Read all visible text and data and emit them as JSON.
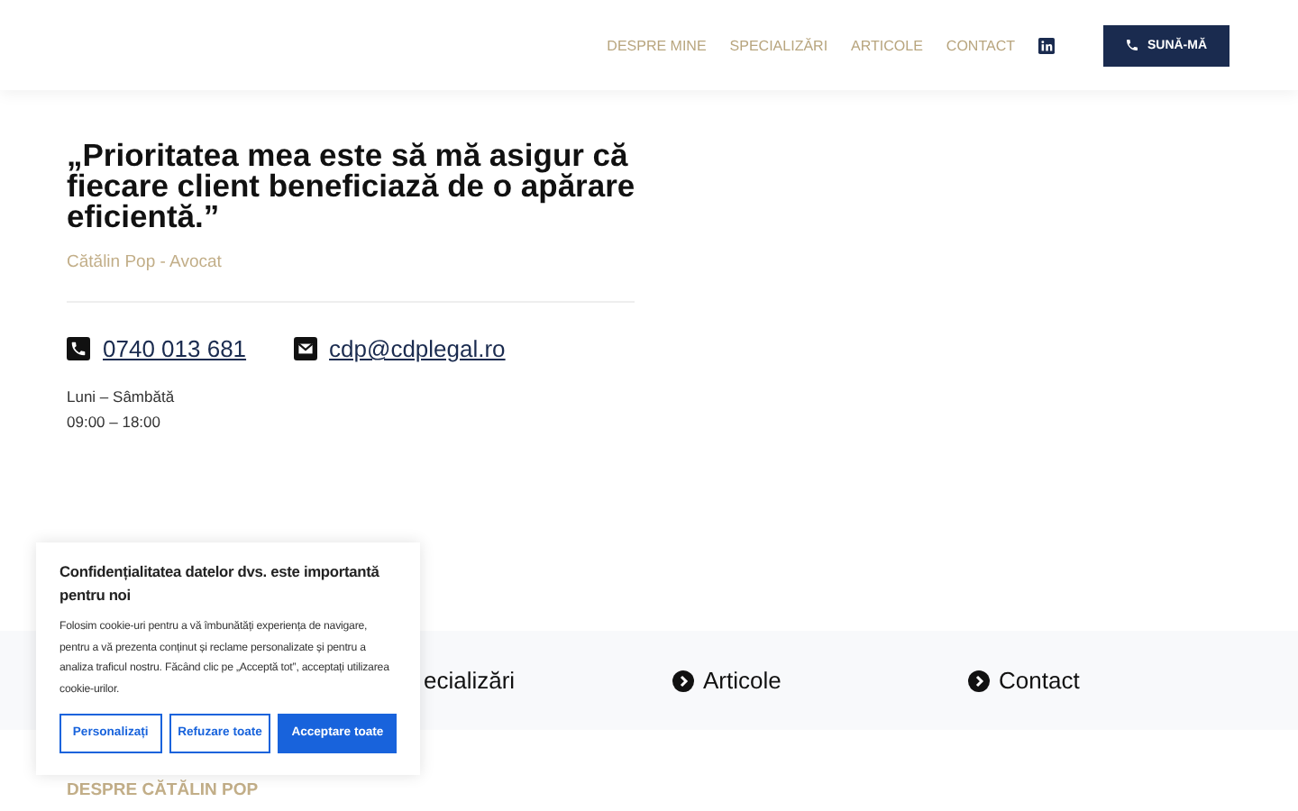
{
  "header": {
    "nav": [
      {
        "label": "DESPRE MINE"
      },
      {
        "label": "SPECIALIZĂRI"
      },
      {
        "label": "ARTICOLE"
      },
      {
        "label": "CONTACT"
      }
    ],
    "call_button": "SUNĂ-MĂ"
  },
  "quote": {
    "text": "„Prioritatea mea este să mă asigur că fiecare client beneficiază de o apărare eficientă.”",
    "author": "Cătălin Pop - Avocat"
  },
  "contacts": [
    {
      "kind": "phone",
      "text": "0740 013 681"
    },
    {
      "kind": "email",
      "text": "cdp@cdplegal.ro"
    }
  ],
  "hours": [
    "Luni – Sâmbătă",
    "09:00 – 18:00"
  ],
  "footer_links": [
    {
      "label": "ecializări",
      "icon": false
    },
    {
      "label": "Articole",
      "icon": true
    },
    {
      "label": "Contact",
      "icon": true
    }
  ],
  "section_heading": "DESPRE CĂTĂLIN POP",
  "cookie_banner": {
    "title": "Confidențialitatea datelor dvs. este importantă pentru noi",
    "text": "Folosim cookie-uri pentru a vă îmbunătăți experiența de navigare, pentru a vă prezenta conținut și reclame personalizate și pentru a analiza traficul nostru. Făcând clic pe „Acceptă tot”, acceptați utilizarea cookie-urilor.",
    "buttons": [
      {
        "label": "Personalizați",
        "kind": "outline"
      },
      {
        "label": "Refuzare toate",
        "kind": "outline"
      },
      {
        "label": "Acceptare toate",
        "kind": "primary"
      }
    ]
  }
}
